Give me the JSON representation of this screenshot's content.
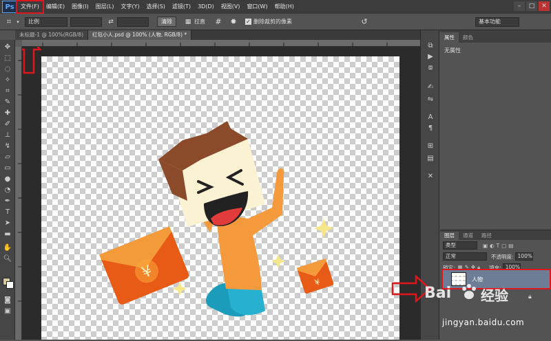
{
  "app": {
    "logo": "Ps"
  },
  "menu": [
    "文件(F)",
    "编辑(E)",
    "图像(I)",
    "图层(L)",
    "文字(Y)",
    "选择(S)",
    "滤镜(T)",
    "3D(D)",
    "视图(V)",
    "窗口(W)",
    "帮助(H)"
  ],
  "options": {
    "ratio_select": "比例",
    "clear_button": "清除",
    "straighten_label": "拉直",
    "delete_cropped_label": "删除裁剪的像素",
    "workspace_select": "基本功能"
  },
  "tabs": [
    {
      "label": "未标题-1 @ 100%(RGB/8)"
    },
    {
      "label": "红包小人.psd @ 100% (人物, RGB/8) *"
    }
  ],
  "properties": {
    "tabs": [
      "属性",
      "颜色"
    ],
    "content": "无属性"
  },
  "layers": {
    "tabs": [
      "图层",
      "通道",
      "路径"
    ],
    "filter_select": "类型",
    "blend_mode": "正常",
    "opacity_label": "不透明度:",
    "opacity_value": "100%",
    "lock_label": "锁定:",
    "fill_label": "填充:",
    "fill_value": "100%",
    "items": [
      {
        "name": "人物"
      }
    ]
  },
  "watermark": {
    "brand": "Bai",
    "brand2": "经验",
    "url": "jingyan.baidu.com"
  },
  "colors": {
    "highlight": "#e0161e",
    "envelope": "#f07020",
    "shirt": "#f59a3c",
    "hair": "#8b4a2a"
  }
}
